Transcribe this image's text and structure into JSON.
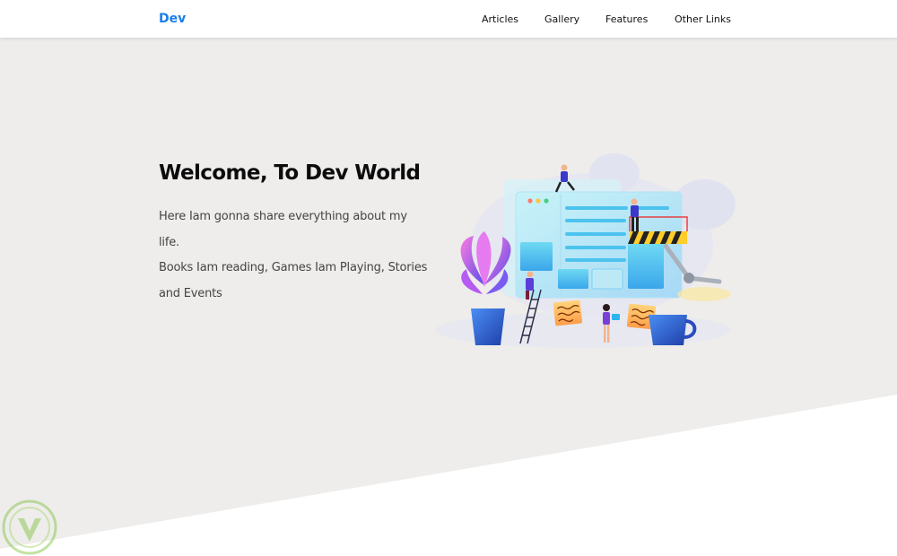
{
  "navbar": {
    "brand": "Dev",
    "brand_color": "#1a7ee8",
    "links": [
      "Articles",
      "Gallery",
      "Features",
      "Other Links"
    ]
  },
  "hero": {
    "title": "Welcome, To Dev World",
    "lines": [
      "Here Iam gonna share everything about my life.",
      "Books Iam reading, Games Iam Playing, Stories",
      "and Events"
    ],
    "background": "#eeedeb",
    "illustration": "web-development-team-illustration"
  },
  "watermark": {
    "icon": "watermark-logo-icon"
  }
}
